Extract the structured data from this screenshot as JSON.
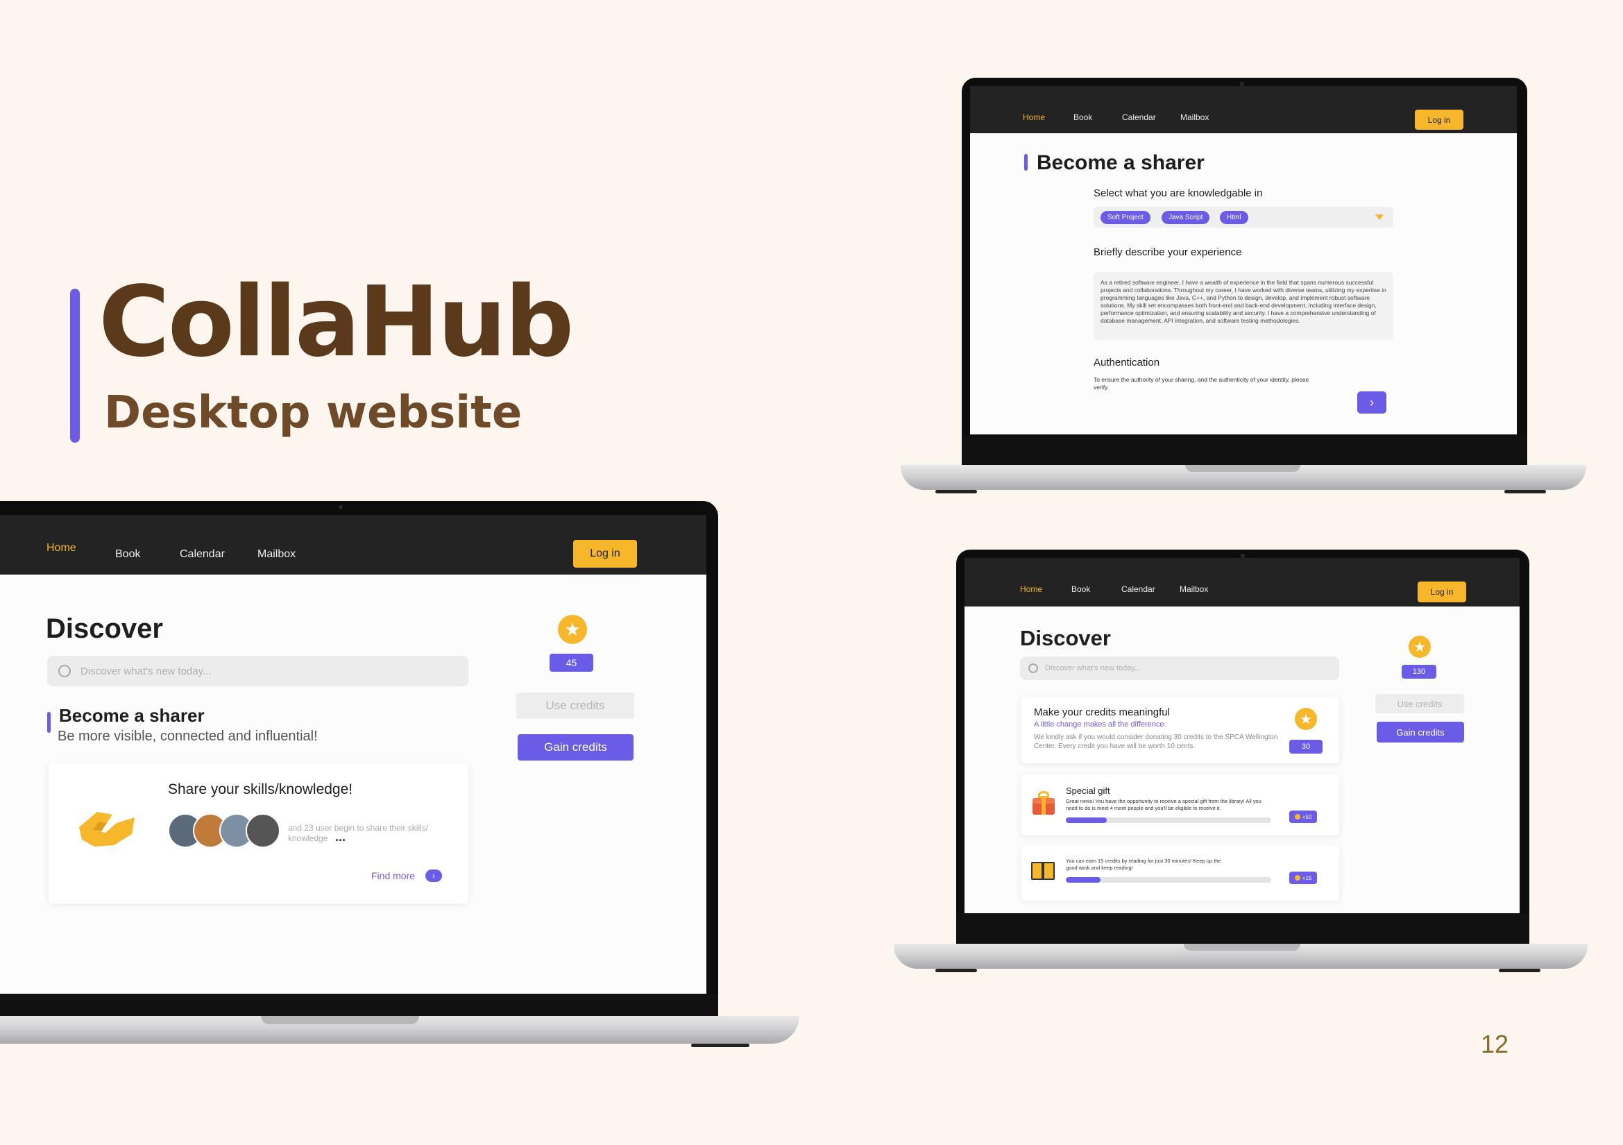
{
  "brand": {
    "name": "CollaHub",
    "subtitle": "Desktop website"
  },
  "page_number": "12",
  "colors": {
    "accent": "#6b5ce7",
    "highlight": "#f6b72b",
    "background": "#fdf6ef",
    "nav": "#232323",
    "brand_text": "#5b3a1c"
  },
  "nav": {
    "items": [
      "Home",
      "Book",
      "Calendar",
      "Mailbox"
    ],
    "active": "Home",
    "login": "Log in"
  },
  "discover_large": {
    "title": "Discover",
    "search_placeholder": "Discover what's new today...",
    "credits": "45",
    "use_credits": "Use credits",
    "gain_credits": "Gain credits",
    "section_title": "Become a sharer",
    "section_subtitle": "Be more visible, connected and influential!",
    "card": {
      "title": "Share your skills/knowledge!",
      "users_text": "and 23 user begin to share their skills/ knowledge",
      "more": "...",
      "find_more": "Find more",
      "icons": [
        "handshake-icon",
        "chevron-right-icon"
      ]
    }
  },
  "sharer_form": {
    "title": "Become a sharer",
    "select_label": "Select what you are knowledgable in",
    "tags": [
      "Soft Project",
      "Java Script",
      "Html"
    ],
    "experience_label": "Briefly describe your experience",
    "experience_text": "As a retired software engineer, I have a wealth of experience in the field that spans numerous successful projects and collaborations. Throughout my career, I have worked with diverse teams, utilizing my expertise in programming languages like Java, C++, and Python to design, develop, and implement robust software solutions. My skill set encompasses both front-end and back-end development, including interface design, performance optimization, and ensuring scalability and security. I have a comprehensive understanding of database management, API integration, and software testing methodologies.",
    "auth_title": "Authentication",
    "auth_text": "To ensure the authority of your sharing, and the authenticity of your identity, please verify."
  },
  "discover_small": {
    "title": "Discover",
    "search_placeholder": "Discover what's new today...",
    "credits": "130",
    "use_credits": "Use credits",
    "gain_credits": "Gain credits",
    "donate": {
      "title": "Make your credits meaningful",
      "subtitle": "A little change makes all the difference.",
      "text": "We kindly ask if you would consider donating 30 credits to the SPCA Wellington Center. Every credit you have will be worth 10 cents.",
      "amount": "30"
    },
    "gift": {
      "title": "Special gift",
      "text": "Great news! You have the opportunity to receive a special gift from the library! All you need to do is meet 4 more people and you'll be eligible to receive it.",
      "reward": "+50",
      "progress": 0.2
    },
    "reading": {
      "text": "You can earn 15 credits by reading for just 30 minutes! Keep up the good work and keep reading!",
      "reward": "+15",
      "progress": 0.17
    }
  }
}
